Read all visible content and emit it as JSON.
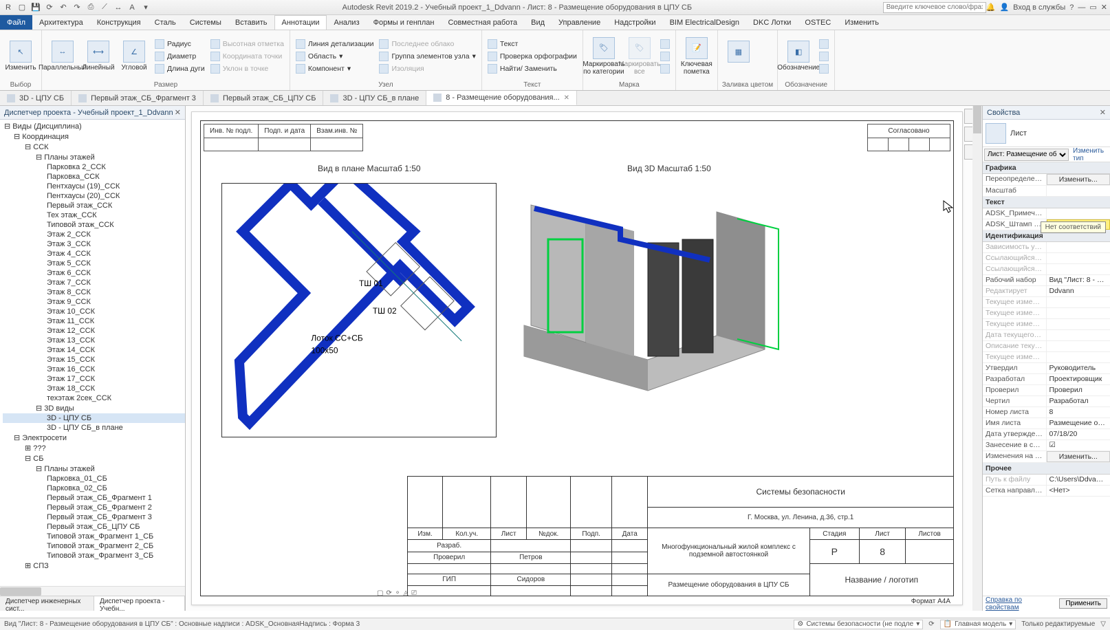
{
  "titlebar": {
    "title": "Autodesk Revit 2019.2 - Учебный проект_1_Ddvann - Лист: 8 - Размещение оборудования в ЦПУ СБ",
    "search_placeholder": "Введите ключевое слово/фразу",
    "signin": "Вход в службы"
  },
  "ribbon_tabs": [
    "Файл",
    "Архитектура",
    "Конструкция",
    "Сталь",
    "Системы",
    "Вставить",
    "Аннотации",
    "Анализ",
    "Формы и генплан",
    "Совместная работа",
    "Вид",
    "Управление",
    "Надстройки",
    "BIM ElectricalDesign",
    "DKC Лотки",
    "OSTEC",
    "Изменить"
  ],
  "ribbon_active": 6,
  "ribbon": {
    "select": {
      "btn": "Изменить",
      "label": "Выбор"
    },
    "size": {
      "btns": [
        "Параллельный",
        "Линейный",
        "Угловой"
      ],
      "items": [
        "Радиус",
        "Диаметр",
        "Длина дуги"
      ],
      "dis": [
        "Высотная отметка",
        "Координата точки",
        "Уклон в точке"
      ],
      "label": "Размер"
    },
    "detail": {
      "items": [
        "Линия детализации",
        "Область",
        "Компонент"
      ],
      "dis2": [
        "Последнее облако",
        "Изоляция"
      ],
      "grp": "Группа элементов узла",
      "label": "Узел"
    },
    "text": {
      "items": [
        "Текст",
        "Проверка орфографии",
        "Найти/ Заменить"
      ],
      "label": "Текст"
    },
    "mark": {
      "btns": [
        "Маркировать по категории",
        "Маркировать все"
      ],
      "label": "Марка"
    },
    "key": {
      "btn": "Ключевая пометка"
    },
    "fill": {
      "label": "Заливка цветом"
    },
    "sym": {
      "btn": "Обозначение",
      "label": "Обозначение"
    }
  },
  "doctabs": [
    {
      "label": "3D - ЦПУ СБ"
    },
    {
      "label": "Первый этаж_СБ_Фрагмент 3"
    },
    {
      "label": "Первый этаж_СБ_ЦПУ СБ"
    },
    {
      "label": "3D - ЦПУ СБ_в плане"
    },
    {
      "label": "8 - Размещение оборудования...",
      "active": true
    }
  ],
  "browser": {
    "title": "Диспетчер проекта - Учебный проект_1_Ddvann",
    "root": "Виды (Дисциплина)",
    "n1": "Координация",
    "n2": "ССК",
    "n3": "Планы этажей",
    "floors": [
      "Парковка 2_ССК",
      "Парковка_ССК",
      "Пентхаусы (19)_ССК",
      "Пентхаусы (20)_ССК",
      "Первый этаж_ССК",
      "Тех этаж_ССК",
      "Типовой этаж_ССК",
      "Этаж 2_ССК",
      "Этаж 3_ССК",
      "Этаж 4_ССК",
      "Этаж 5_ССК",
      "Этаж 6_ССК",
      "Этаж 7_ССК",
      "Этаж 8_ССК",
      "Этаж 9_ССК",
      "Этаж 10_ССК",
      "Этаж 11_ССК",
      "Этаж 12_ССК",
      "Этаж 13_ССК",
      "Этаж 14_ССК",
      "Этаж 15_ССК",
      "Этаж 16_ССК",
      "Этаж 17_ССК",
      "Этаж 18_ССК",
      "техэтаж 2сек_ССК"
    ],
    "n3d": "3D виды",
    "v3d": [
      "3D - ЦПУ СБ",
      "3D - ЦПУ СБ_в плане"
    ],
    "nE": "Электросети",
    "nQ": "???",
    "nSB": "СБ",
    "nSBp": "Планы этажей",
    "sb": [
      "Парковка_01_СБ",
      "Парковка_02_СБ",
      "Первый этаж_СБ_Фрагмент 1",
      "Первый этаж_СБ_Фрагмент 2",
      "Первый этаж_СБ_Фрагмент 3",
      "Первый этаж_СБ_ЦПУ СБ",
      "Типовой этаж_Фрагмент 1_СБ",
      "Типовой этаж_Фрагмент 2_СБ",
      "Типовой этаж_Фрагмент 3_СБ"
    ],
    "nSPZ": "СПЗ",
    "ft1": "Диспетчер инженерных сист...",
    "ft2": "Диспетчер проекта - Учебн..."
  },
  "sheet": {
    "top": {
      "c1": "Инв. № подл.",
      "c2": "Подп. и дата",
      "c3": "Взам.инв. №",
      "c4": "Согласовано"
    },
    "plan_title": "Вид в плане   Масштаб 1:50",
    "d3_title": "Вид 3D   Масштаб 1:50",
    "plan": {
      "t1": "ТШ 01",
      "t2": "ТШ 02",
      "t3": "Лоток СС+СБ",
      "t4": "100x50"
    },
    "stamp": {
      "h": [
        "Изм.",
        "Кол.уч.",
        "Лист",
        "№док.",
        "Подп.",
        "Дата"
      ],
      "r1": "Разраб.",
      "r2": "Проверил",
      "r2n": "Петров",
      "r3": "ГИП",
      "r3n": "Сидоров",
      "title1": "Системы безопасности",
      "addr": "Г. Москва, ул. Ленина, д.36, стр.1",
      "desc": "Многофункциональный жилой комплекс с подземной автостоянкой",
      "sheet_name": "Размещение оборудования в ЦПУ СБ",
      "st": "Стадия",
      "stv": "Р",
      "sh": "Лист",
      "shv": "8",
      "shs": "Листов",
      "logo": "Название / логотип",
      "fmt": "Формат А4А"
    }
  },
  "props": {
    "title": "Свойства",
    "type": "Лист",
    "filter": "Лист: Размещение об",
    "edit_type": "Изменить тип",
    "groups": {
      "g1": "Графика",
      "g2": "Текст",
      "g3": "Идентификация",
      "g4": "Прочее"
    },
    "rows": [
      {
        "k": "Переопределения...",
        "v": "Изменить...",
        "btn": true
      },
      {
        "k": "Масштаб",
        "v": ""
      },
      {
        "k": "ADSK_Примечание",
        "v": ""
      },
      {
        "k": "ADSK_Штамп Стр...",
        "v": "",
        "hl": true
      },
      {
        "k": "Зависимость уро...",
        "v": "",
        "dis": true
      },
      {
        "k": "Ссылающийся ли...",
        "v": "",
        "dis": true
      },
      {
        "k": "Ссылающийся узел",
        "v": "",
        "dis": true
      },
      {
        "k": "Рабочий набор",
        "v": "Вид \"Лист: 8 - Раз..."
      },
      {
        "k": "Редактирует",
        "v": "Ddvann",
        "dis": true
      },
      {
        "k": "Текущее изменен...",
        "v": "",
        "dis": true
      },
      {
        "k": "Текущее изменен...",
        "v": "",
        "dis": true
      },
      {
        "k": "Текущее изменен...",
        "v": "",
        "dis": true
      },
      {
        "k": "Дата текущего из...",
        "v": "",
        "dis": true
      },
      {
        "k": "Описание текуще...",
        "v": "",
        "dis": true
      },
      {
        "k": "Текущее изменен...",
        "v": "",
        "dis": true
      },
      {
        "k": "Утвердил",
        "v": "Руководитель"
      },
      {
        "k": "Разработал",
        "v": "Проектировщик"
      },
      {
        "k": "Проверил",
        "v": "Проверил"
      },
      {
        "k": "Чертил",
        "v": "Разработал"
      },
      {
        "k": "Номер листа",
        "v": "8"
      },
      {
        "k": "Имя листа",
        "v": "Размещение обор..."
      },
      {
        "k": "Дата утверждения...",
        "v": "07/18/20"
      },
      {
        "k": "Занесение в спис...",
        "v": "☑"
      },
      {
        "k": "Изменения на ли...",
        "v": "Изменить...",
        "btn": true
      },
      {
        "k": "Путь к файлу",
        "v": "C:\\Users\\Ddvann\\D...",
        "dis": true
      },
      {
        "k": "Сетка направляю...",
        "v": "<Нет>"
      }
    ],
    "tooltip": "Нет соответствий",
    "help": "Справка по свойствам",
    "apply": "Применить"
  },
  "status": {
    "left": "Вид \"Лист: 8 - Размещение оборудования в ЦПУ СБ\" : Основные надписи : ADSK_ОсновнаяНадпись : Форма 3",
    "combo1": "Системы безопасности (не подле",
    "combo2": "Главная модель",
    "right": "Только редактируемые"
  },
  "viewbar": ":0"
}
